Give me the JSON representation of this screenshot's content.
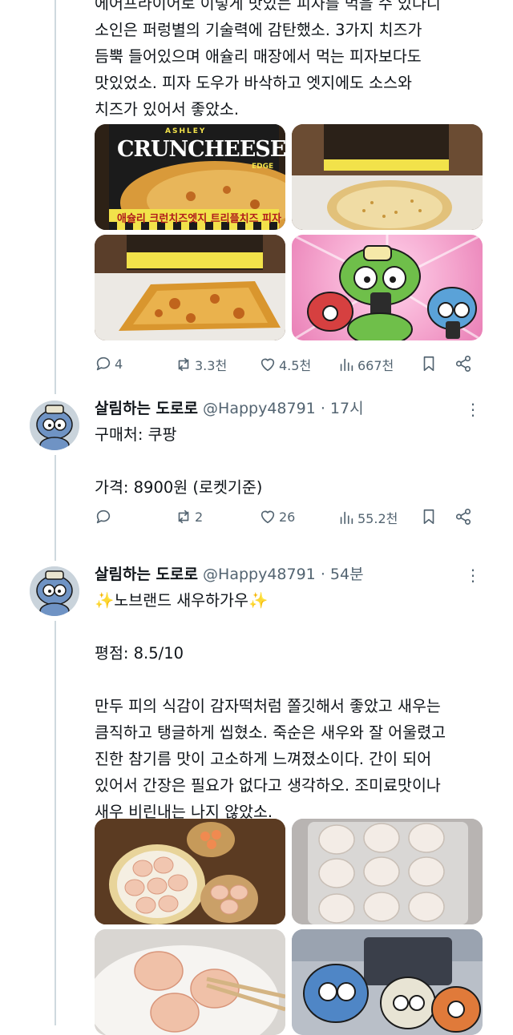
{
  "tweet1": {
    "text_lines": [
      "에어프라이어로 이렇게 맛있는 피자를 먹을 수 있다니",
      "소인은 퍼렁별의 기술력에 감탄했소. 3가지 치즈가",
      "듬뿍 들어있으며 애슐리 매장에서 먹는 피자보다도",
      "맛있었소. 피자 도우가 바삭하고 엣지에도 소스와",
      "치즈가 있어서 좋았소."
    ],
    "media": {
      "box_brand": "ASHLEY",
      "box_title": "CRUNCHEESE",
      "box_edge": "EDGE",
      "box_korean": "애슐리 크런치즈엣지 트리플치즈 피자"
    },
    "actions": {
      "replies": "4",
      "retweets": "3.3천",
      "likes": "4.5천",
      "views": "667천"
    }
  },
  "tweet2": {
    "name": "살림하는 도로로",
    "handle": "@Happy48791",
    "time": "· 17시",
    "lines": [
      "구매처: 쿠팡",
      "",
      "가격: 8900원 (로켓기준)"
    ],
    "actions": {
      "replies": "",
      "retweets": "2",
      "likes": "26",
      "views": "55.2천"
    }
  },
  "tweet3": {
    "name": "살림하는 도로로",
    "handle": "@Happy48791",
    "time": "· 54분",
    "lines": [
      "✨노브랜드 새우하가우✨",
      "",
      "평점: 8.5/10",
      "",
      "만두 피의 식감이 감자떡처럼 쫄깃해서 좋았고 새우는",
      "큼직하고 탱글하게 씹혔소. 죽순은 새우와 잘 어울렸고",
      "진한 참기름 맛이 고소하게 느껴졌소이다. 간이 되어",
      "있어서 간장은 필요가 없다고 생각하오. 조미료맛이나",
      "새우 비린내는 나지 않았소."
    ]
  },
  "colors": {
    "text": "#0f1419",
    "muted": "#536471",
    "line": "#cfd9de"
  }
}
